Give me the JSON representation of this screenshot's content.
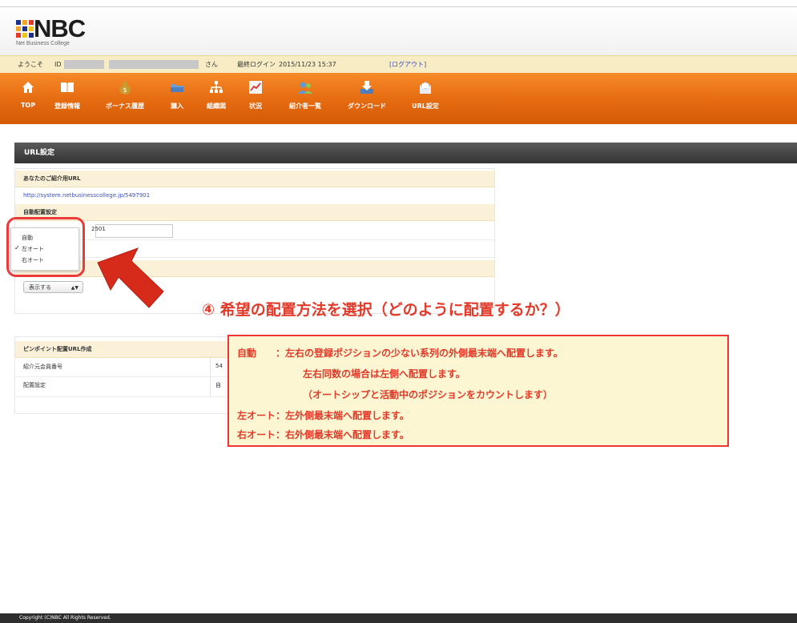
{
  "header": {
    "logo_text": "NBC",
    "logo_subtitle": "Net Business College"
  },
  "welcome": {
    "greeting": "ようこそ",
    "id_label": "ID",
    "san": "さん",
    "last_login_label": "最終ログイン",
    "last_login_value": "2015/11/23 15:37",
    "logout": "[ログアウト]"
  },
  "nav": {
    "items": [
      {
        "label": "TOP",
        "icon": "home-icon"
      },
      {
        "label": "登録情報",
        "icon": "book-icon"
      },
      {
        "label": "ボーナス履歴",
        "icon": "money-bag-icon"
      },
      {
        "label": "購入",
        "icon": "folder-icon"
      },
      {
        "label": "組織図",
        "icon": "org-chart-icon"
      },
      {
        "label": "状況",
        "icon": "chart-icon"
      },
      {
        "label": "紹介者一覧",
        "icon": "people-icon"
      },
      {
        "label": "ダウンロード",
        "icon": "download-icon"
      },
      {
        "label": "URL設定",
        "icon": "envelope-icon"
      }
    ]
  },
  "section": {
    "title": "URL設定"
  },
  "form": {
    "referral_url_label": "あなたのご紹介用URL",
    "referral_url": "http://system.netbusinesscollege.jp/5497901",
    "placement_label": "自動配置設定",
    "input_value": "2501",
    "display_select_value": "表示する"
  },
  "dropdown": {
    "options": [
      "自動",
      "左オート",
      "右オート"
    ],
    "selected_index": 1
  },
  "pinpoint": {
    "title": "ピンポイント配置URL作成",
    "row1_label": "紹介元会員番号",
    "row1_value": "54",
    "row2_label": "配置設定",
    "row2_value": "自"
  },
  "annotation": {
    "title": "④ 希望の配置方法を選択（どのように配置するか？）",
    "lines": [
      "自動　　：左右の登録ポジションの少ない系列の外側最末端へ配置します。",
      "左右同数の場合は左側へ配置します。",
      "（オートシップと活動中のポジションをカウントします）",
      "左オート：左外側最末端へ配置します。",
      "右オート：右外側最末端へ配置します。"
    ]
  },
  "footer": {
    "copyright": "Copyright (C)NBC All Rights Reserved."
  },
  "colors": {
    "nav_orange": "#e8700f",
    "welcome_bg": "#f7ecc4",
    "accent_red": "#e23a2a",
    "link_blue": "#3a50c0"
  }
}
